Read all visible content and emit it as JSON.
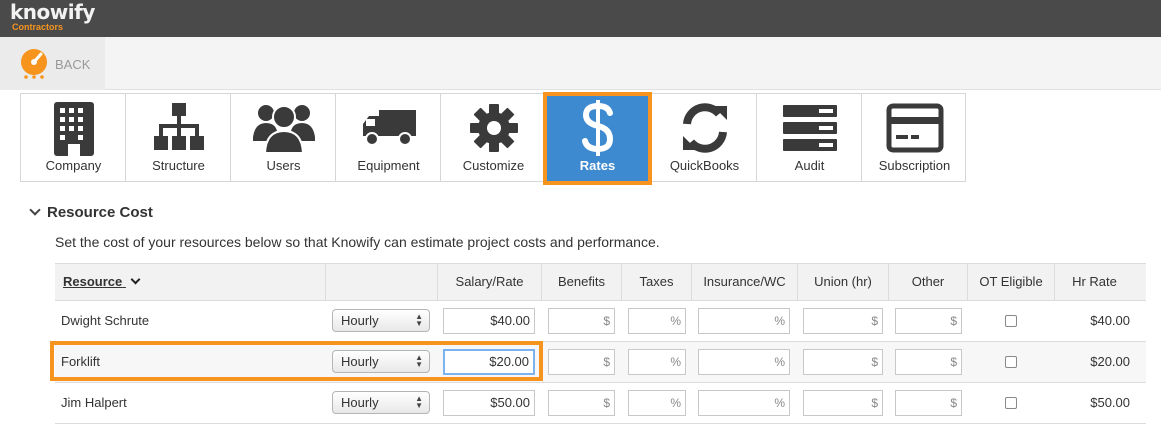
{
  "app": {
    "logo": "knowify",
    "logo_sub": "Contractors",
    "back_label": "BACK"
  },
  "tabs": [
    {
      "label": "Company",
      "icon": "building-icon"
    },
    {
      "label": "Structure",
      "icon": "org-chart-icon"
    },
    {
      "label": "Users",
      "icon": "users-icon"
    },
    {
      "label": "Equipment",
      "icon": "truck-icon"
    },
    {
      "label": "Customize",
      "icon": "gear-icon"
    },
    {
      "label": "Rates",
      "icon": "dollar-icon",
      "active": true
    },
    {
      "label": "QuickBooks",
      "icon": "sync-icon"
    },
    {
      "label": "Audit",
      "icon": "server-list-icon"
    },
    {
      "label": "Subscription",
      "icon": "credit-card-icon"
    }
  ],
  "section": {
    "title": "Resource Cost",
    "description": "Set the cost of your resources below so that Knowify can estimate project costs and performance."
  },
  "table": {
    "headers": {
      "resource": "Resource",
      "salary": "Salary/Rate",
      "benefits": "Benefits",
      "taxes": "Taxes",
      "insurance": "Insurance/WC",
      "union": "Union (hr)",
      "other": "Other",
      "ot": "OT Eligible",
      "hr_rate": "Hr Rate"
    },
    "rows": [
      {
        "name": "Dwight Schrute",
        "type": "Hourly",
        "salary": "$40.00",
        "benefits": "$",
        "taxes": "%",
        "insurance": "%",
        "union": "$",
        "other": "$",
        "hr_rate": "$40.00"
      },
      {
        "name": "Forklift",
        "type": "Hourly",
        "salary": "$20.00",
        "benefits": "$",
        "taxes": "%",
        "insurance": "%",
        "union": "$",
        "other": "$",
        "hr_rate": "$20.00"
      },
      {
        "name": "Jim Halpert",
        "type": "Hourly",
        "salary": "$50.00",
        "benefits": "$",
        "taxes": "%",
        "insurance": "%",
        "union": "$",
        "other": "$",
        "hr_rate": "$50.00"
      }
    ]
  },
  "colors": {
    "accent": "#f7941d",
    "active_tab": "#3e8ad0",
    "topbar": "#4a4a4a"
  }
}
